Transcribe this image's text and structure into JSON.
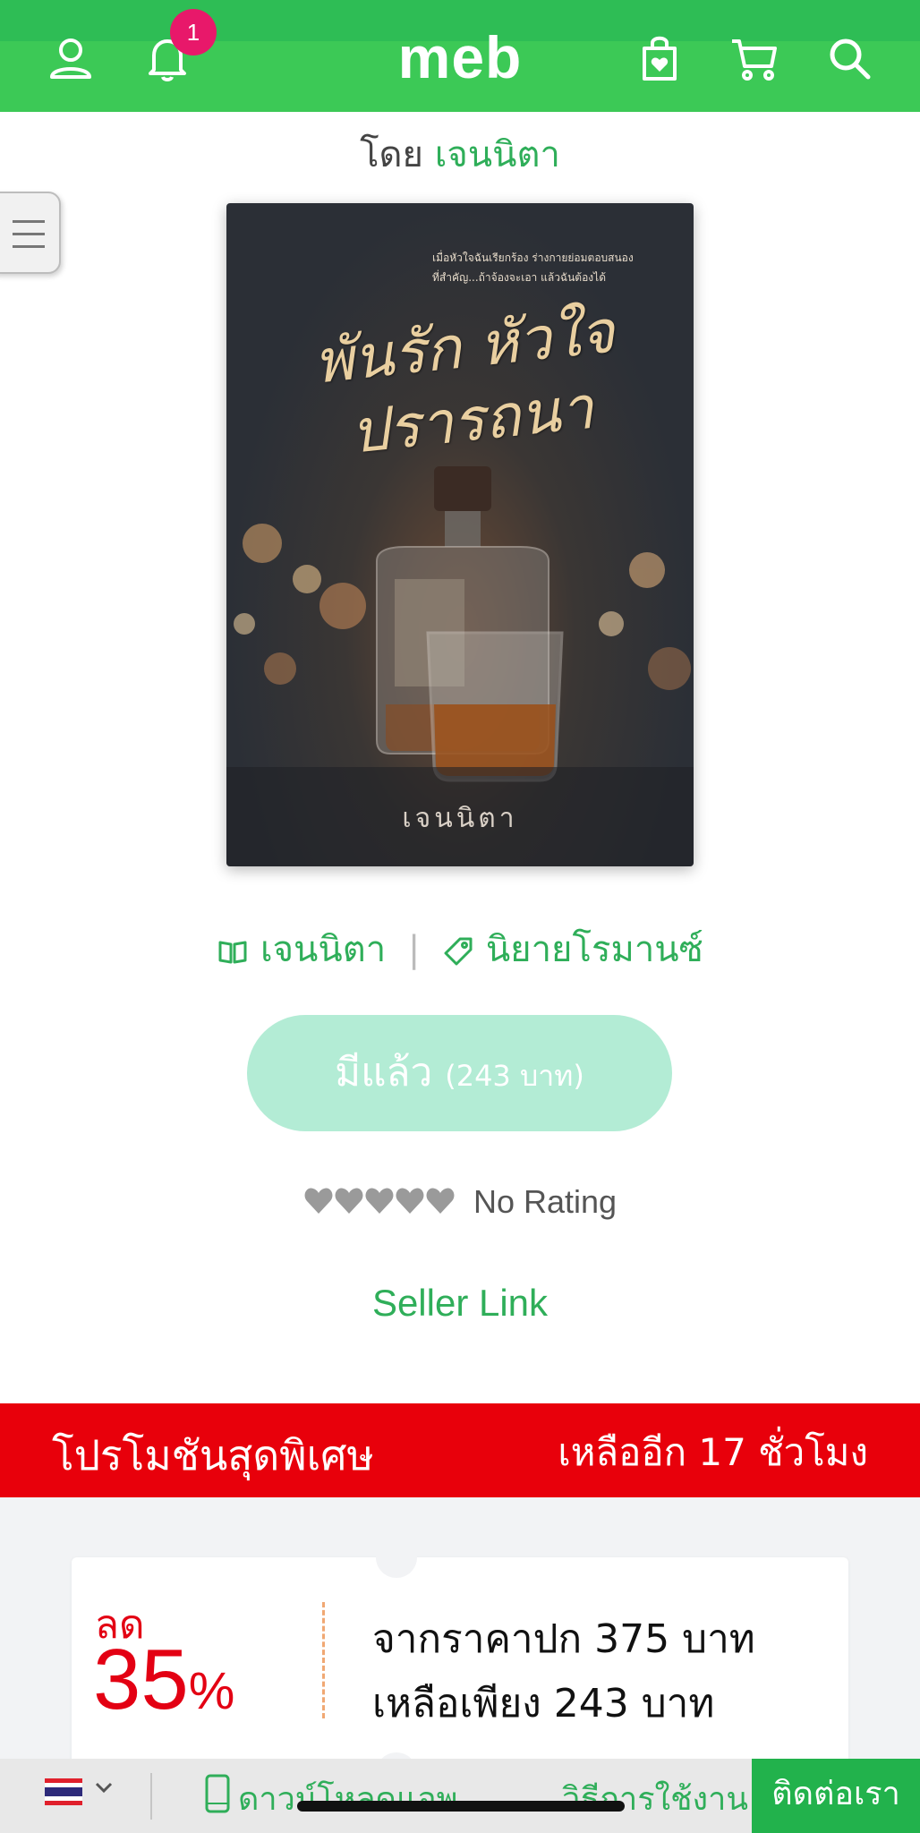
{
  "header": {
    "logo": "meb",
    "notification_count": "1",
    "icons": [
      "user-icon",
      "bell-icon",
      "wishlist-bag-icon",
      "cart-icon",
      "search-icon"
    ]
  },
  "book": {
    "by_label": "โดย",
    "author": "เจนนิตา",
    "cover_tagline_1": "เมื่อหัวใจฉันเรียกร้อง ร่างกายย่อมตอบสนอง",
    "cover_tagline_2": "ที่สำคัญ...ถ้าจ้องจะเอา แล้วฉันต้องได้",
    "cover_title": "พันรัก หัวใจปรารถนา",
    "cover_author": "เจนนิตา",
    "meta_author": "เจนนิตา",
    "meta_category": "นิยายโรมานซ์"
  },
  "purchase": {
    "owned_label": "มีแล้ว",
    "owned_price": "(243 บาท)"
  },
  "rating": {
    "hearts": 0,
    "label": "No Rating"
  },
  "seller_link": "Seller Link",
  "promo": {
    "title": "โปรโมชันสุดพิเศษ",
    "time_left": "เหลืออีก 17 ชั่วโมง",
    "discount_label": "ลด",
    "discount_value": "35",
    "discount_unit": "%",
    "original_price_text": "จากราคาปก 375 บาท",
    "final_price_text": "เหลือเพียง 243 บาท"
  },
  "bottom_bar": {
    "download_label": "ดาวน์โหลดแอพ",
    "howto_label": "วิธีการใช้งาน",
    "contact_label": "ติดต่อเรา"
  },
  "colors": {
    "brand_green": "#3cc956",
    "link_green": "#2fae59",
    "promo_red": "#e8000b",
    "badge_pink": "#e8186a",
    "owned_button": "#b3ecd5"
  }
}
